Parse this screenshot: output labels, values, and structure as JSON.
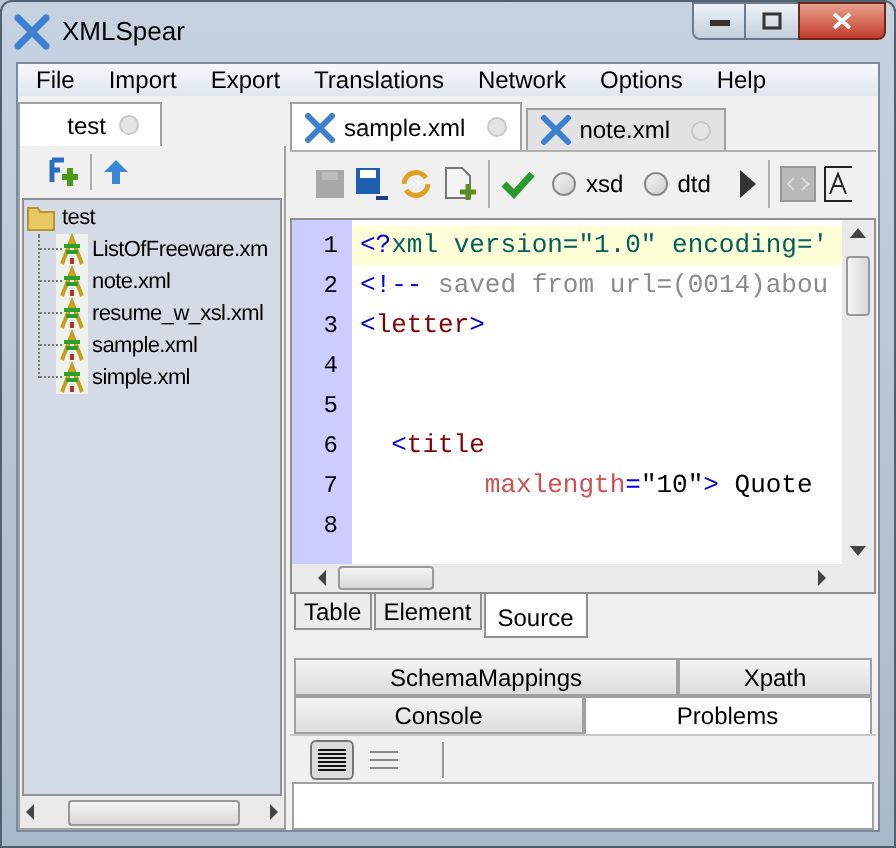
{
  "window": {
    "title": "XMLSpear"
  },
  "menu": [
    "File",
    "Import",
    "Export",
    "Translations",
    "Network",
    "Options",
    "Help"
  ],
  "left_panel": {
    "tabs": [
      {
        "label": "test",
        "selected": true
      }
    ],
    "tree": [
      {
        "label": "test",
        "kind": "folder",
        "children": [
          {
            "label": "ListOfFreeware.xm",
            "kind": "file"
          },
          {
            "label": "note.xml",
            "kind": "file"
          },
          {
            "label": "resume_w_xsl.xml",
            "kind": "file"
          },
          {
            "label": "sample.xml",
            "kind": "file"
          },
          {
            "label": "simple.xml",
            "kind": "file"
          }
        ]
      }
    ]
  },
  "editor": {
    "tabs": [
      {
        "label": "sample.xml",
        "selected": true
      },
      {
        "label": "note.xml",
        "selected": false
      }
    ],
    "toolbar": {
      "radios": [
        {
          "label": "xsd",
          "checked": false
        },
        {
          "label": "dtd",
          "checked": false
        }
      ]
    },
    "lines": [
      {
        "number": "1",
        "current": true,
        "segments": [
          {
            "kind": "punct",
            "text": "<?"
          },
          {
            "kind": "pi",
            "text": "xml version=\"1.0\" encoding='"
          }
        ]
      },
      {
        "number": "2",
        "current": false,
        "segments": [
          {
            "kind": "punct",
            "text": "<!--"
          },
          {
            "kind": "comment",
            "text": " saved from url=(0014)abou"
          }
        ]
      },
      {
        "number": "3",
        "current": false,
        "segments": [
          {
            "kind": "punct",
            "text": "<"
          },
          {
            "kind": "tag",
            "text": "letter"
          },
          {
            "kind": "punct",
            "text": ">"
          }
        ]
      },
      {
        "number": "4",
        "current": false
      },
      {
        "number": "5",
        "current": false
      },
      {
        "number": "6",
        "current": false,
        "segments": [
          {
            "kind": "punct",
            "text": "  <"
          },
          {
            "kind": "tag",
            "text": "title"
          }
        ]
      },
      {
        "number": "7",
        "current": false,
        "segments": [
          {
            "kind": "attr",
            "text": "        maxlength"
          },
          {
            "kind": "punct",
            "text": "="
          },
          {
            "kind": "value",
            "text": "\"10\""
          },
          {
            "kind": "punct",
            "text": ">"
          },
          {
            "kind": "text",
            "text": " Quote"
          }
        ]
      },
      {
        "number": "8",
        "current": false
      }
    ],
    "view_tabs": [
      {
        "label": "Table",
        "selected": false
      },
      {
        "label": "Element",
        "selected": false
      },
      {
        "label": "Source",
        "selected": true
      }
    ]
  },
  "bottom_panel": {
    "tab_rows": [
      [
        {
          "label": "SchemaMappings",
          "selected": false
        },
        {
          "label": "Xpath",
          "selected": false
        }
      ],
      [
        {
          "label": "Console",
          "selected": false
        },
        {
          "label": "Problems",
          "selected": true
        }
      ]
    ],
    "view_buttons": [
      {
        "kind": "detailed",
        "selected": true
      },
      {
        "kind": "simple",
        "selected": false
      }
    ]
  }
}
